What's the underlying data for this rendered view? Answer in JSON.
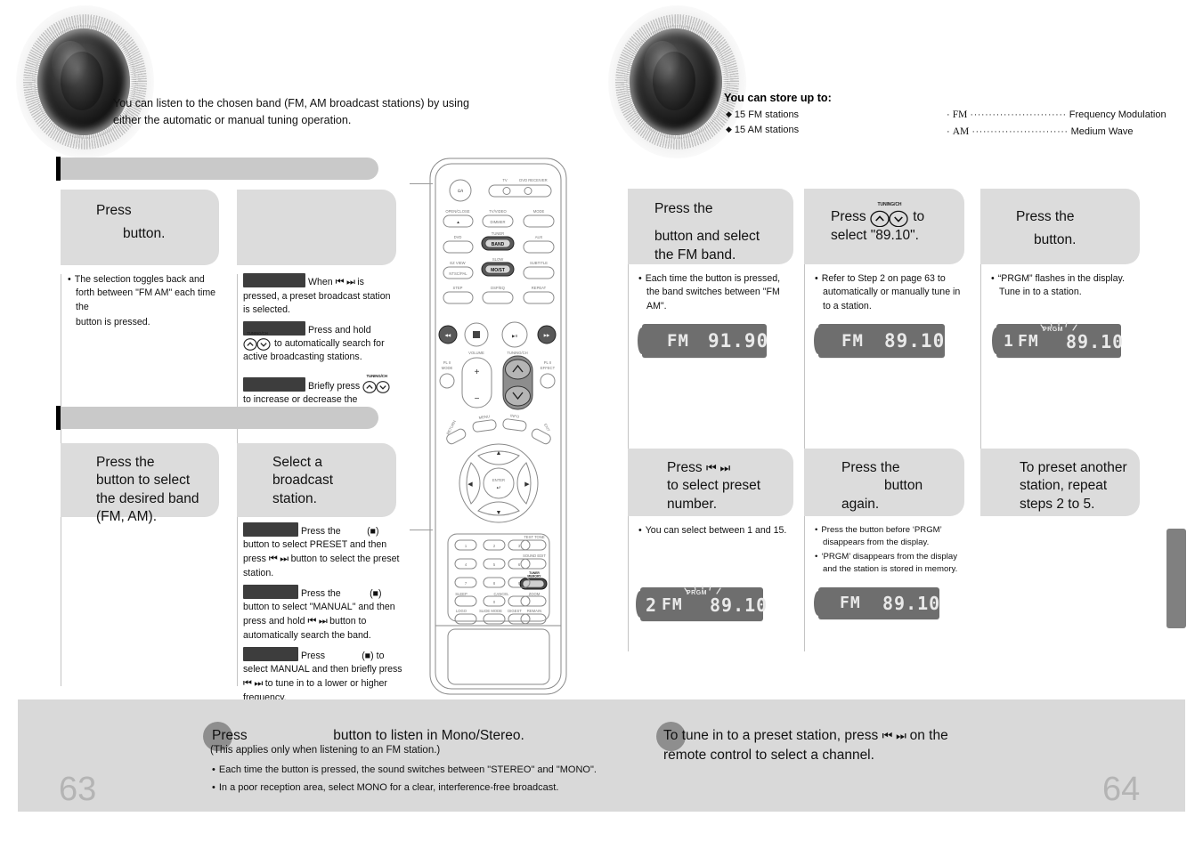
{
  "left_page": {
    "page_number": "63",
    "intro": "You can listen to the chosen band (FM, AM broadcast stations) by using either the automatic or manual tuning operation.",
    "section_1_heading": "",
    "section_2_heading": "",
    "cards": [
      {
        "head_line1": "Press",
        "head_line2": "button.",
        "bullets": [
          "The selection toggles back and forth between \"FM    AM\" each time the",
          "button is pressed."
        ]
      },
      {
        "head_line1": "",
        "head_line2": "",
        "items": [
          {
            "chip": true,
            "text": "When ⏮ ⏭ is pressed, a preset broadcast station is selected."
          },
          {
            "chip": true,
            "text": "Press and hold ▲ ▼ to automatically search for active broadcasting stations."
          },
          {
            "chip": true,
            "text": "Briefly press ▲ ▼ to increase or decrease the frequency incrementally."
          }
        ]
      },
      {
        "head_line1": "Press the",
        "head_line2": "button to select the desired band (FM, AM).",
        "bullets": []
      },
      {
        "head_line1": "Select a broadcast",
        "head_line2": "station.",
        "items": [
          {
            "chip": true,
            "text": "Press the           (■) button to select PRESET and then press ⏮ ⏭ button to select the preset station."
          },
          {
            "chip": true,
            "text": "Press the           (■) button to select \"MANUAL\" and then press and hold ⏮ ⏭ button to automatically search the band."
          },
          {
            "chip": true,
            "text": "Press           (■) to select MANUAL and then briefly press ⏮ ⏭ to tune in to a lower or higher frequency."
          }
        ]
      }
    ],
    "note": {
      "title_pre": "Press",
      "title_post": "button to listen in Mono/Stereo.",
      "subtitle": "(This applies only when listening to an FM station.)",
      "bullets": [
        "Each time the button is pressed, the sound switches between \"STEREO\" and \"MONO\".",
        "In a poor reception area, select MONO for a clear, interference-free broadcast."
      ]
    }
  },
  "right_page": {
    "page_number": "64",
    "store_title": "You can store up to:",
    "store_items": [
      "15 FM stations",
      "15 AM stations"
    ],
    "glossary": [
      {
        "term": "FM",
        "dots": "··························",
        "definition": "Frequency Modulation"
      },
      {
        "term": "AM",
        "dots": "··························",
        "definition": "Medium Wave"
      }
    ],
    "steps": [
      {
        "head_line1": "Press the",
        "head_line2": "button  and select the FM band.",
        "bullets": [
          "Each time the button is pressed, the band switches between \"FM    AM\"."
        ],
        "display": {
          "preset": "",
          "band": "FM",
          "freq": "91.90",
          "prgm": false
        }
      },
      {
        "head_line1": "Press",
        "head_line2": "select \"89.10\".",
        "head_mid": " to",
        "button_label": "TUNING/CH",
        "bullets": [
          "Refer to Step 2 on page 63 to automatically or manually tune in to a station."
        ],
        "display": {
          "preset": "",
          "band": "FM",
          "freq": "89.10",
          "prgm": false
        }
      },
      {
        "head_line1": "Press the",
        "head_line2": "button.",
        "bullets": [
          "“PRGM” flashes in the display. Tune in to a station."
        ],
        "display": {
          "preset": "1",
          "band": "FM",
          "freq": "89.10",
          "prgm": true,
          "prgm_label": "PRGM"
        }
      },
      {
        "head_line1": "Press",
        "head_line2": "to select preset number.",
        "bullets": [
          "You can select between 1 and 15."
        ],
        "display": {
          "preset": "2",
          "band": "FM",
          "freq": "89.10",
          "prgm": true,
          "prgm_label": "PRGM"
        }
      },
      {
        "head_line1": "Press the",
        "head_line2": "button",
        "head_line3": "again.",
        "bullets": [
          "Press the                         button before ‘PRGM’ disappears from the display.",
          "‘PRGM’ disappears from the display and the station is stored in memory."
        ],
        "display": {
          "preset": "",
          "band": "FM",
          "freq": "89.10",
          "prgm": false
        }
      },
      {
        "head_line1": "To preset another",
        "head_line2": "station, repeat",
        "head_line3": "steps 2 to 5.",
        "bullets": [],
        "display": null
      }
    ],
    "note": {
      "line1_pre": "To tune in to a preset station, press",
      "line1_post": "on the",
      "line2": "remote control to select a channel."
    }
  },
  "remote": {
    "labels": {
      "tv": "TV",
      "dvd_receiver": "DVD RECEIVER",
      "open_close": "OPEN/CLOSE",
      "tv_video": "TV/VIDEO",
      "dimmer": "DIMMER",
      "mode": "MODE",
      "dvd": "DVD",
      "tuner": "TUNER",
      "band": "BAND",
      "aux": "AUX",
      "ez_view": "EZ VIEW",
      "ntsc_pal": "NTSC/PAL",
      "slow": "SLOW",
      "mo_st": "MO/ST",
      "subtitle": "SUBTITLE",
      "step": "STEP",
      "dsp_eq": "DSP/EQ",
      "repeat": "REPEAT",
      "volume": "VOLUME",
      "tuning_ch": "TUNING/CH",
      "pl_mode": "PL II MODE",
      "pl_effect": "PL II EFFECT",
      "menu": "MENU",
      "info": "INFO",
      "return": "RETURN",
      "exit": "EXIT",
      "enter": "ENTER",
      "test_tone": "TEST TONE",
      "sound_edit": "SOUND EDIT",
      "tuner_memory": "TUNER MEMORY",
      "sleep": "SLEEP",
      "cancel": "CANCEL",
      "zoom": "ZOOM",
      "logo": "LOGO",
      "slide_mode": "SLIDE MODE",
      "digest": "DIGEST",
      "remain": "REMAIN",
      "keypad": [
        "1",
        "2",
        "3",
        "4",
        "5",
        "6",
        "7",
        "8",
        "9",
        "0"
      ]
    }
  },
  "colors": {
    "card_head_bg": "#dcdcdc",
    "heading_bar_bg": "#c9c9c9",
    "chip_bg": "#3d3d3d",
    "led_bg": "#6e6e6e",
    "led_text": "#e9e9e9",
    "banner_bg": "#d9d9d9",
    "page_number": "#b4b4b4",
    "edge_tab": "#808080"
  }
}
